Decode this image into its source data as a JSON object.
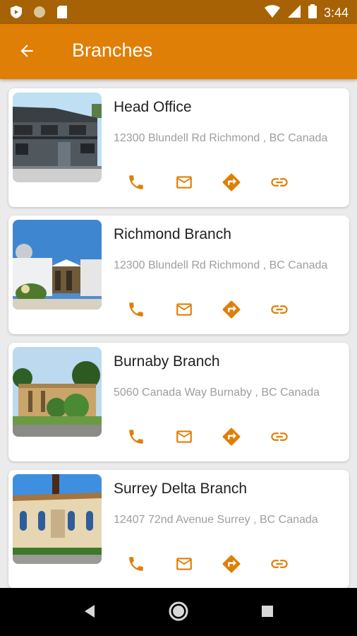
{
  "status_bar": {
    "time": "3:44",
    "icons": [
      "shield-icon",
      "circle-icon",
      "sd-card-icon",
      "wifi-icon",
      "signal-icon",
      "battery-icon"
    ]
  },
  "app_bar": {
    "title": "Branches",
    "back_icon": "arrow-back-icon"
  },
  "branches": [
    {
      "name": "Head Office",
      "address": "12300 Blundell Rd Richmond , BC Canada",
      "image": "two-storey office building"
    },
    {
      "name": "Richmond Branch",
      "address": "12300 Blundell Rd Richmond , BC Canada",
      "image": "white domed building"
    },
    {
      "name": "Burnaby Branch",
      "address": "5060 Canada Way Burnaby , BC Canada",
      "image": "tan building with trees"
    },
    {
      "name": "Surrey Delta Branch",
      "address": "12407 72nd Avenue Surrey , BC Canada",
      "image": "cream building with minaret"
    }
  ],
  "actions": [
    "phone-icon",
    "mail-icon",
    "directions-icon",
    "link-icon"
  ],
  "colors": {
    "accent": "#e07f05",
    "status_bar": "#a66205",
    "background": "#ebebeb",
    "address_text": "#9e9e9e"
  },
  "nav_bar": [
    "back-triangle-icon",
    "home-circle-icon",
    "recents-square-icon"
  ]
}
